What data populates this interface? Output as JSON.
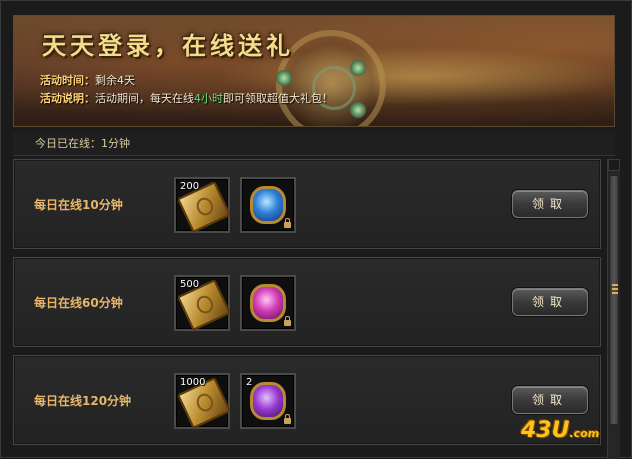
{
  "banner": {
    "title": "天天登录，在线送礼",
    "time_label": "活动时间：",
    "time_value": "剩余4天",
    "desc_label": "活动说明：",
    "desc_before": "活动期间，每天在线",
    "desc_highlight": "4小时",
    "desc_after": "即可领取超值大礼包！"
  },
  "online_status": "今日已在线：1分钟",
  "rewards": [
    {
      "label": "每日在线10分钟",
      "items": [
        {
          "icon": "gold-ticket-icon",
          "count": "200"
        },
        {
          "icon": "blue-gem-bag-icon",
          "count": "",
          "locked": true
        }
      ],
      "button": "领取"
    },
    {
      "label": "每日在线60分钟",
      "items": [
        {
          "icon": "gold-ticket-icon",
          "count": "500"
        },
        {
          "icon": "pink-gem-bag-icon",
          "count": "",
          "locked": true
        }
      ],
      "button": "领取"
    },
    {
      "label": "每日在线120分钟",
      "items": [
        {
          "icon": "gold-ticket-icon",
          "count": "1000"
        },
        {
          "icon": "purple-gem-bag-icon",
          "count": "2",
          "locked": true
        }
      ],
      "button": "领取"
    }
  ],
  "watermark": {
    "main": "43U",
    "suffix": ".com"
  },
  "colors": {
    "accent_gold": "#e8b66a",
    "highlight_green": "#66e07a",
    "label_orange": "#ffd27a"
  }
}
